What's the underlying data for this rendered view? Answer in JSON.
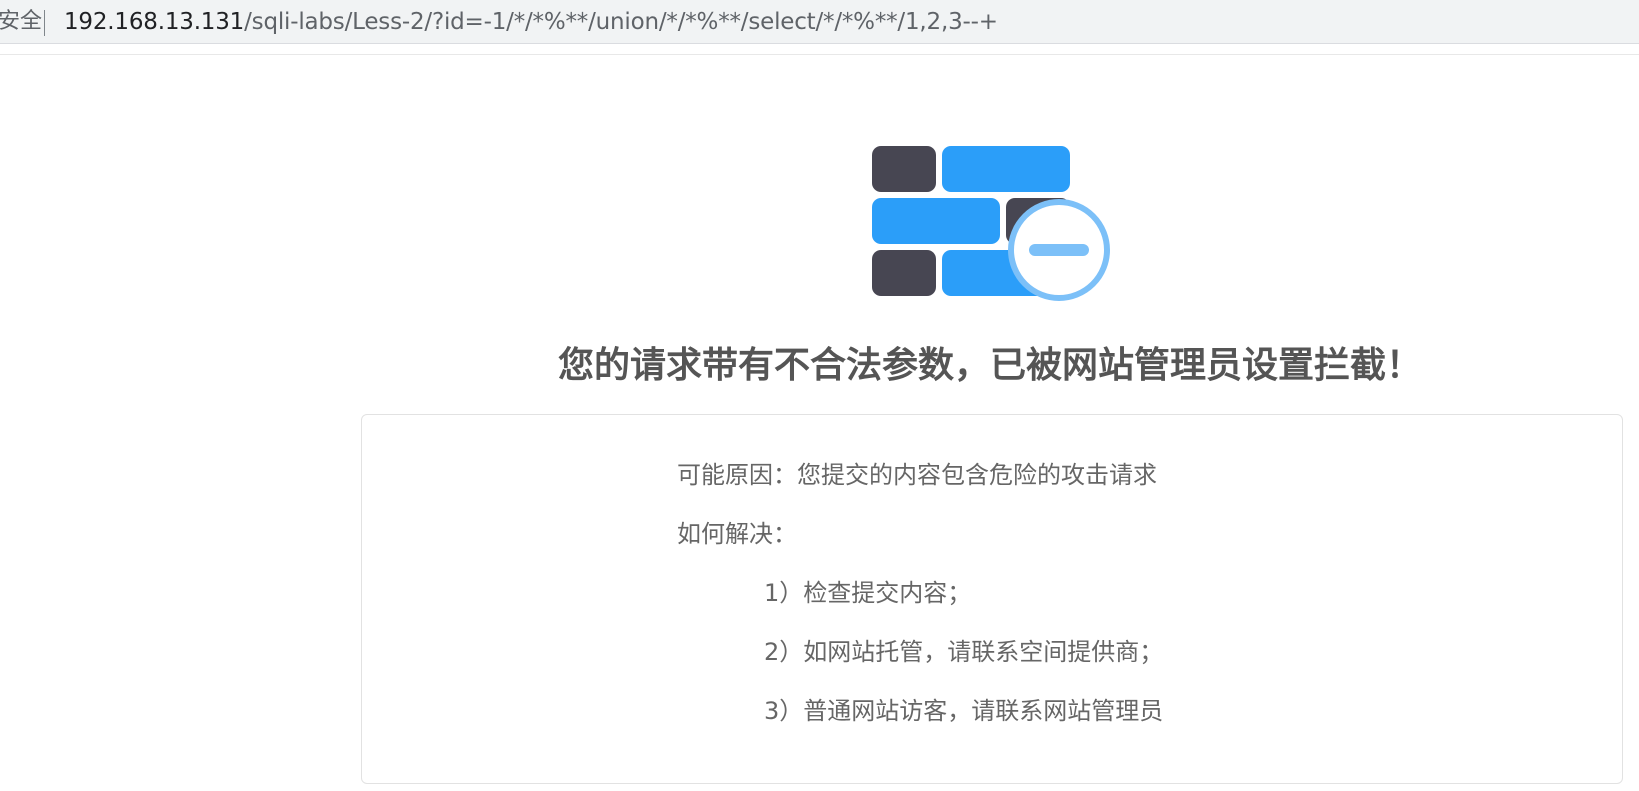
{
  "browser": {
    "security_label": "安全",
    "url_host": "192.168.13.131",
    "url_path": "/sqli-labs/Less-2/?id=-1/*/*%**/union/*/*%**/select/*/*%**/1,2,3--+"
  },
  "firewall_icon": {
    "dark_color": "#474652",
    "blue_color": "#2b9ef9",
    "badge_color": "#7cc0f8",
    "name": "firewall-block-icon"
  },
  "main": {
    "title": "您的请求带有不合法参数，已被网站管理员设置拦截！",
    "reason": "可能原因：您提交的内容包含危险的攻击请求",
    "solution_heading": "如何解决：",
    "steps": [
      "1）检查提交内容；",
      "2）如网站托管，请联系空间提供商；",
      "3）普通网站访客，请联系网站管理员"
    ]
  }
}
